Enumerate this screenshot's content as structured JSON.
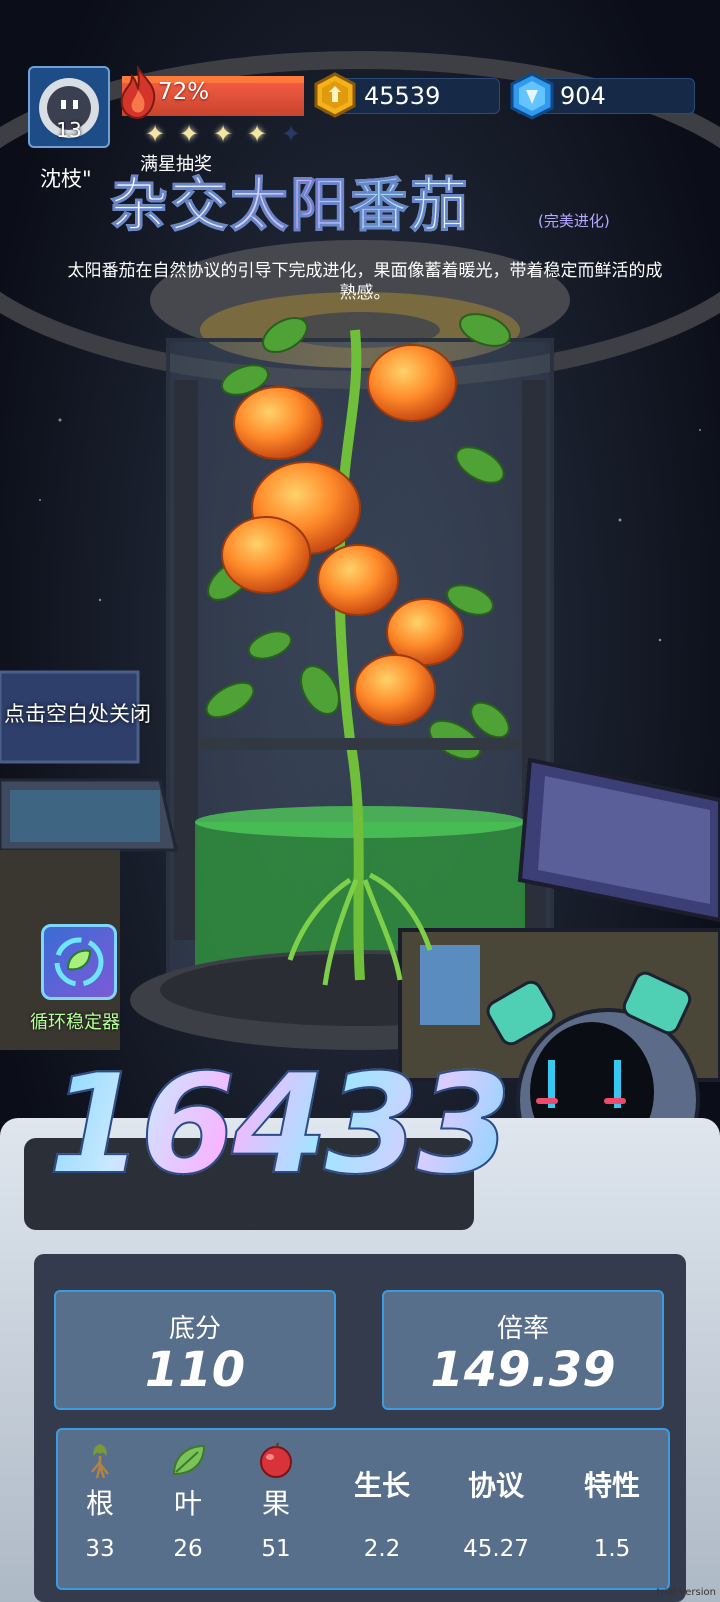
{
  "player": {
    "name": "沈枝\"",
    "level": "13"
  },
  "energy": {
    "percent_label": "72%",
    "percent": 72
  },
  "stars": {
    "filled": 4,
    "total": 5
  },
  "currency": {
    "gold": "45539",
    "gems": "904"
  },
  "lottery_label": "满星抽奖",
  "plant": {
    "title": "杂交太阳番茄",
    "evolution_tag": "(完美进化)",
    "description": "太阳番茄在自然协议的引导下完成进化，果面像蓄着暖光，带着稳定而鲜活的成熟感。"
  },
  "close_hint": "点击空白处关闭",
  "stabilizer": {
    "label": "循环稳定器",
    "icon": "leaf-cycle-icon"
  },
  "score": "16433",
  "stats": {
    "base_label": "底分",
    "base_value": "110",
    "mult_label": "倍率",
    "mult_value": "149.39"
  },
  "attributes": [
    {
      "name": "根",
      "value": "33",
      "icon": "root-icon"
    },
    {
      "name": "叶",
      "value": "26",
      "icon": "leaf-icon"
    },
    {
      "name": "果",
      "value": "51",
      "icon": "apple-icon"
    },
    {
      "name": "生长",
      "value": "2.2"
    },
    {
      "name": "协议",
      "value": "45.27"
    },
    {
      "name": "特性",
      "value": "1.5"
    }
  ],
  "watermark": "trial version",
  "colors": {
    "energy": "#e2533a",
    "accent_border": "#3e9bdf",
    "stat_card": "#586f8c"
  }
}
